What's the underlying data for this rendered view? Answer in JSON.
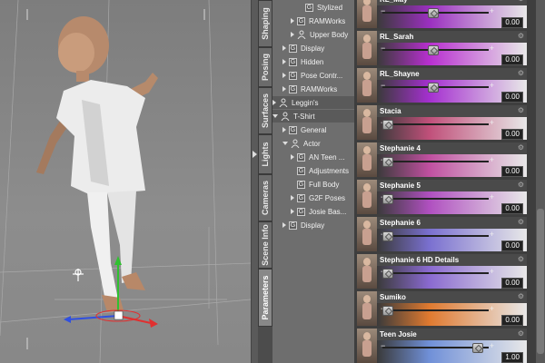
{
  "tabs": [
    {
      "label": "Shaping",
      "active": false
    },
    {
      "label": "Posing",
      "active": false
    },
    {
      "label": "Surfaces",
      "active": false
    },
    {
      "label": "Lights",
      "active": false
    },
    {
      "label": "Cameras",
      "active": false
    },
    {
      "label": "Scene Info",
      "active": false
    },
    {
      "label": "Parameters",
      "active": true
    }
  ],
  "tree": {
    "items": [
      {
        "label": "Stylized",
        "kind": "g",
        "expand": "none",
        "level": 3
      },
      {
        "label": "RAMWorks",
        "kind": "g",
        "expand": "right",
        "level": 2
      },
      {
        "label": "Upper Body",
        "kind": "fig",
        "expand": "right",
        "level": 2
      },
      {
        "label": "Display",
        "kind": "g",
        "expand": "right",
        "level": 1
      },
      {
        "label": "Hidden",
        "kind": "g",
        "expand": "right",
        "level": 1
      },
      {
        "label": "Pose Contr...",
        "kind": "g",
        "expand": "right",
        "level": 1
      },
      {
        "label": "RAMWorks",
        "kind": "g",
        "expand": "right",
        "level": 1
      },
      {
        "label": "Leggin's",
        "kind": "fig",
        "expand": "right",
        "level": 0,
        "group": true
      },
      {
        "label": "T-Shirt",
        "kind": "fig",
        "expand": "down",
        "level": 0,
        "group": true
      },
      {
        "label": "General",
        "kind": "g",
        "expand": "right",
        "level": 1
      },
      {
        "label": "Actor",
        "kind": "fig",
        "expand": "down",
        "level": 1
      },
      {
        "label": "AN Teen ...",
        "kind": "g",
        "expand": "right",
        "level": 2
      },
      {
        "label": "Adjustments",
        "kind": "g",
        "expand": "none",
        "level": 2
      },
      {
        "label": "Full Body",
        "kind": "g",
        "expand": "none",
        "level": 2
      },
      {
        "label": "G2F Poses",
        "kind": "g",
        "expand": "right",
        "level": 2
      },
      {
        "label": "Josie Bas...",
        "kind": "g",
        "expand": "right",
        "level": 2
      },
      {
        "label": "Display",
        "kind": "g",
        "expand": "right",
        "level": 1
      }
    ]
  },
  "morphs": [
    {
      "name": "RL_May",
      "value": "0.00",
      "knob": 0.5,
      "color": "#9b2fc0"
    },
    {
      "name": "RL_Sarah",
      "value": "0.00",
      "knob": 0.5,
      "color": "#b82fd0"
    },
    {
      "name": "RL_Shayne",
      "value": "0.00",
      "knob": 0.5,
      "color": "#a530d0"
    },
    {
      "name": "Stacia",
      "value": "0.00",
      "knob": 0.0,
      "color": "#c0507a"
    },
    {
      "name": "Stephanie 4",
      "value": "0.00",
      "knob": 0.0,
      "color": "#c050a0"
    },
    {
      "name": "Stephanie 5",
      "value": "0.00",
      "knob": 0.0,
      "color": "#b050c0"
    },
    {
      "name": "Stephanie 6",
      "value": "0.00",
      "knob": 0.0,
      "color": "#7a70d0"
    },
    {
      "name": "Stephanie 6 HD Details",
      "value": "0.00",
      "knob": 0.0,
      "color": "#8a6ad0"
    },
    {
      "name": "Sumiko",
      "value": "0.00",
      "knob": 0.0,
      "color": "#e07a30"
    },
    {
      "name": "Teen Josie",
      "value": "1.00",
      "knob": 1.0,
      "color": "#7090d8"
    }
  ],
  "viewport": {
    "label": "3D viewport"
  }
}
